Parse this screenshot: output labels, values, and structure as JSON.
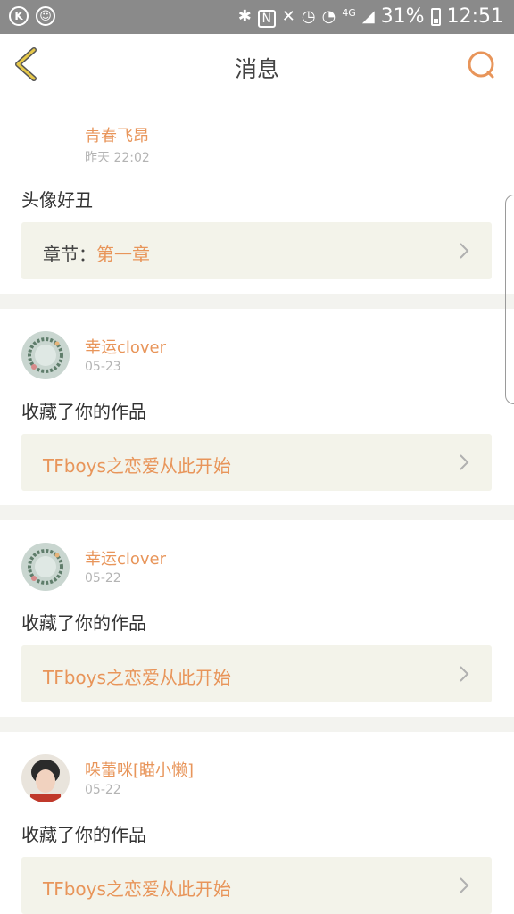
{
  "status_bar": {
    "battery": "31%",
    "time": "12:51",
    "network": "4G",
    "left_icon_letter": "K"
  },
  "header": {
    "title": "消息",
    "back_icon": "chevron-left-icon",
    "search_icon": "search-icon"
  },
  "colors": {
    "accent": "#e8955a",
    "back_arrow": "#e6c84a",
    "ref_bg": "#f3f3ea",
    "status_bar_bg": "#8a8a8a"
  },
  "messages": [
    {
      "user": "青春飞昂",
      "date": "昨天 22:02",
      "text": "头像好丑",
      "ref_prefix": "章节：",
      "ref_title": "第一章",
      "avatar": "blank"
    },
    {
      "user": "幸运clover",
      "date": "05-23",
      "text": "收藏了你的作品",
      "ref_prefix": "",
      "ref_title": "TFboys之恋爱从此开始",
      "avatar": "wreath"
    },
    {
      "user": "幸运clover",
      "date": "05-22",
      "text": "收藏了你的作品",
      "ref_prefix": "",
      "ref_title": "TFboys之恋爱从此开始",
      "avatar": "wreath"
    },
    {
      "user": "哚蕾咪[瞄小懒]",
      "date": "05-22",
      "text": "收藏了你的作品",
      "ref_prefix": "",
      "ref_title": "TFboys之恋爱从此开始",
      "avatar": "photo"
    }
  ]
}
